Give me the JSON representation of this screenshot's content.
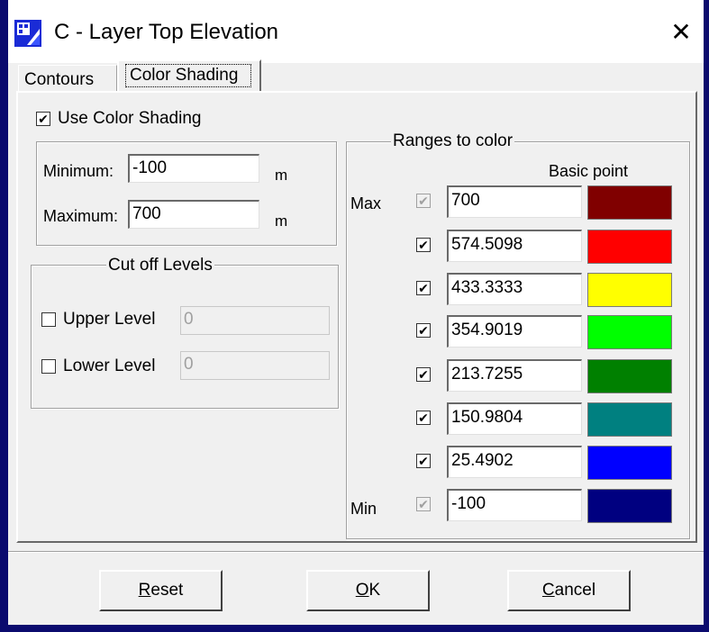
{
  "window": {
    "title": "C - Layer Top Elevation",
    "close_glyph": "✕",
    "icon": "layer-app-icon"
  },
  "tabs": [
    {
      "label": "Contours"
    },
    {
      "label": "Color Shading",
      "selected": true
    }
  ],
  "shading": {
    "use_label": "Use Color Shading",
    "use_checked": true,
    "minimum_label": "Minimum:",
    "minimum_value": "-100",
    "minimum_unit": "m",
    "maximum_label": "Maximum:",
    "maximum_value": "700",
    "maximum_unit": "m"
  },
  "cutoff": {
    "title": "Cut off Levels",
    "upper_label": "Upper Level",
    "upper_checked": false,
    "upper_value": "0",
    "lower_label": "Lower Level",
    "lower_checked": false,
    "lower_value": "0"
  },
  "ranges": {
    "title": "Ranges to color",
    "column_header": "Basic point",
    "max_label": "Max",
    "min_label": "Min",
    "rows": [
      {
        "value": "700",
        "checked": true,
        "enabled": false,
        "color": "#800000"
      },
      {
        "value": "574.5098",
        "checked": true,
        "enabled": true,
        "color": "#ff0000"
      },
      {
        "value": "433.3333",
        "checked": true,
        "enabled": true,
        "color": "#ffff00"
      },
      {
        "value": "354.9019",
        "checked": true,
        "enabled": true,
        "color": "#00ff00"
      },
      {
        "value": "213.7255",
        "checked": true,
        "enabled": true,
        "color": "#008000"
      },
      {
        "value": "150.9804",
        "checked": true,
        "enabled": true,
        "color": "#008080"
      },
      {
        "value": "25.4902",
        "checked": true,
        "enabled": true,
        "color": "#0000ff"
      },
      {
        "value": "-100",
        "checked": true,
        "enabled": false,
        "color": "#000080"
      }
    ]
  },
  "buttons": {
    "reset_label": "Reset",
    "reset_mnemonic": "R",
    "reset_rest": "eset",
    "ok_label": "OK",
    "ok_mnemonic": "O",
    "ok_rest": "K",
    "cancel_label": "Cancel",
    "cancel_mnemonic": "C",
    "cancel_rest": "ancel"
  },
  "check_glyph": "✔"
}
